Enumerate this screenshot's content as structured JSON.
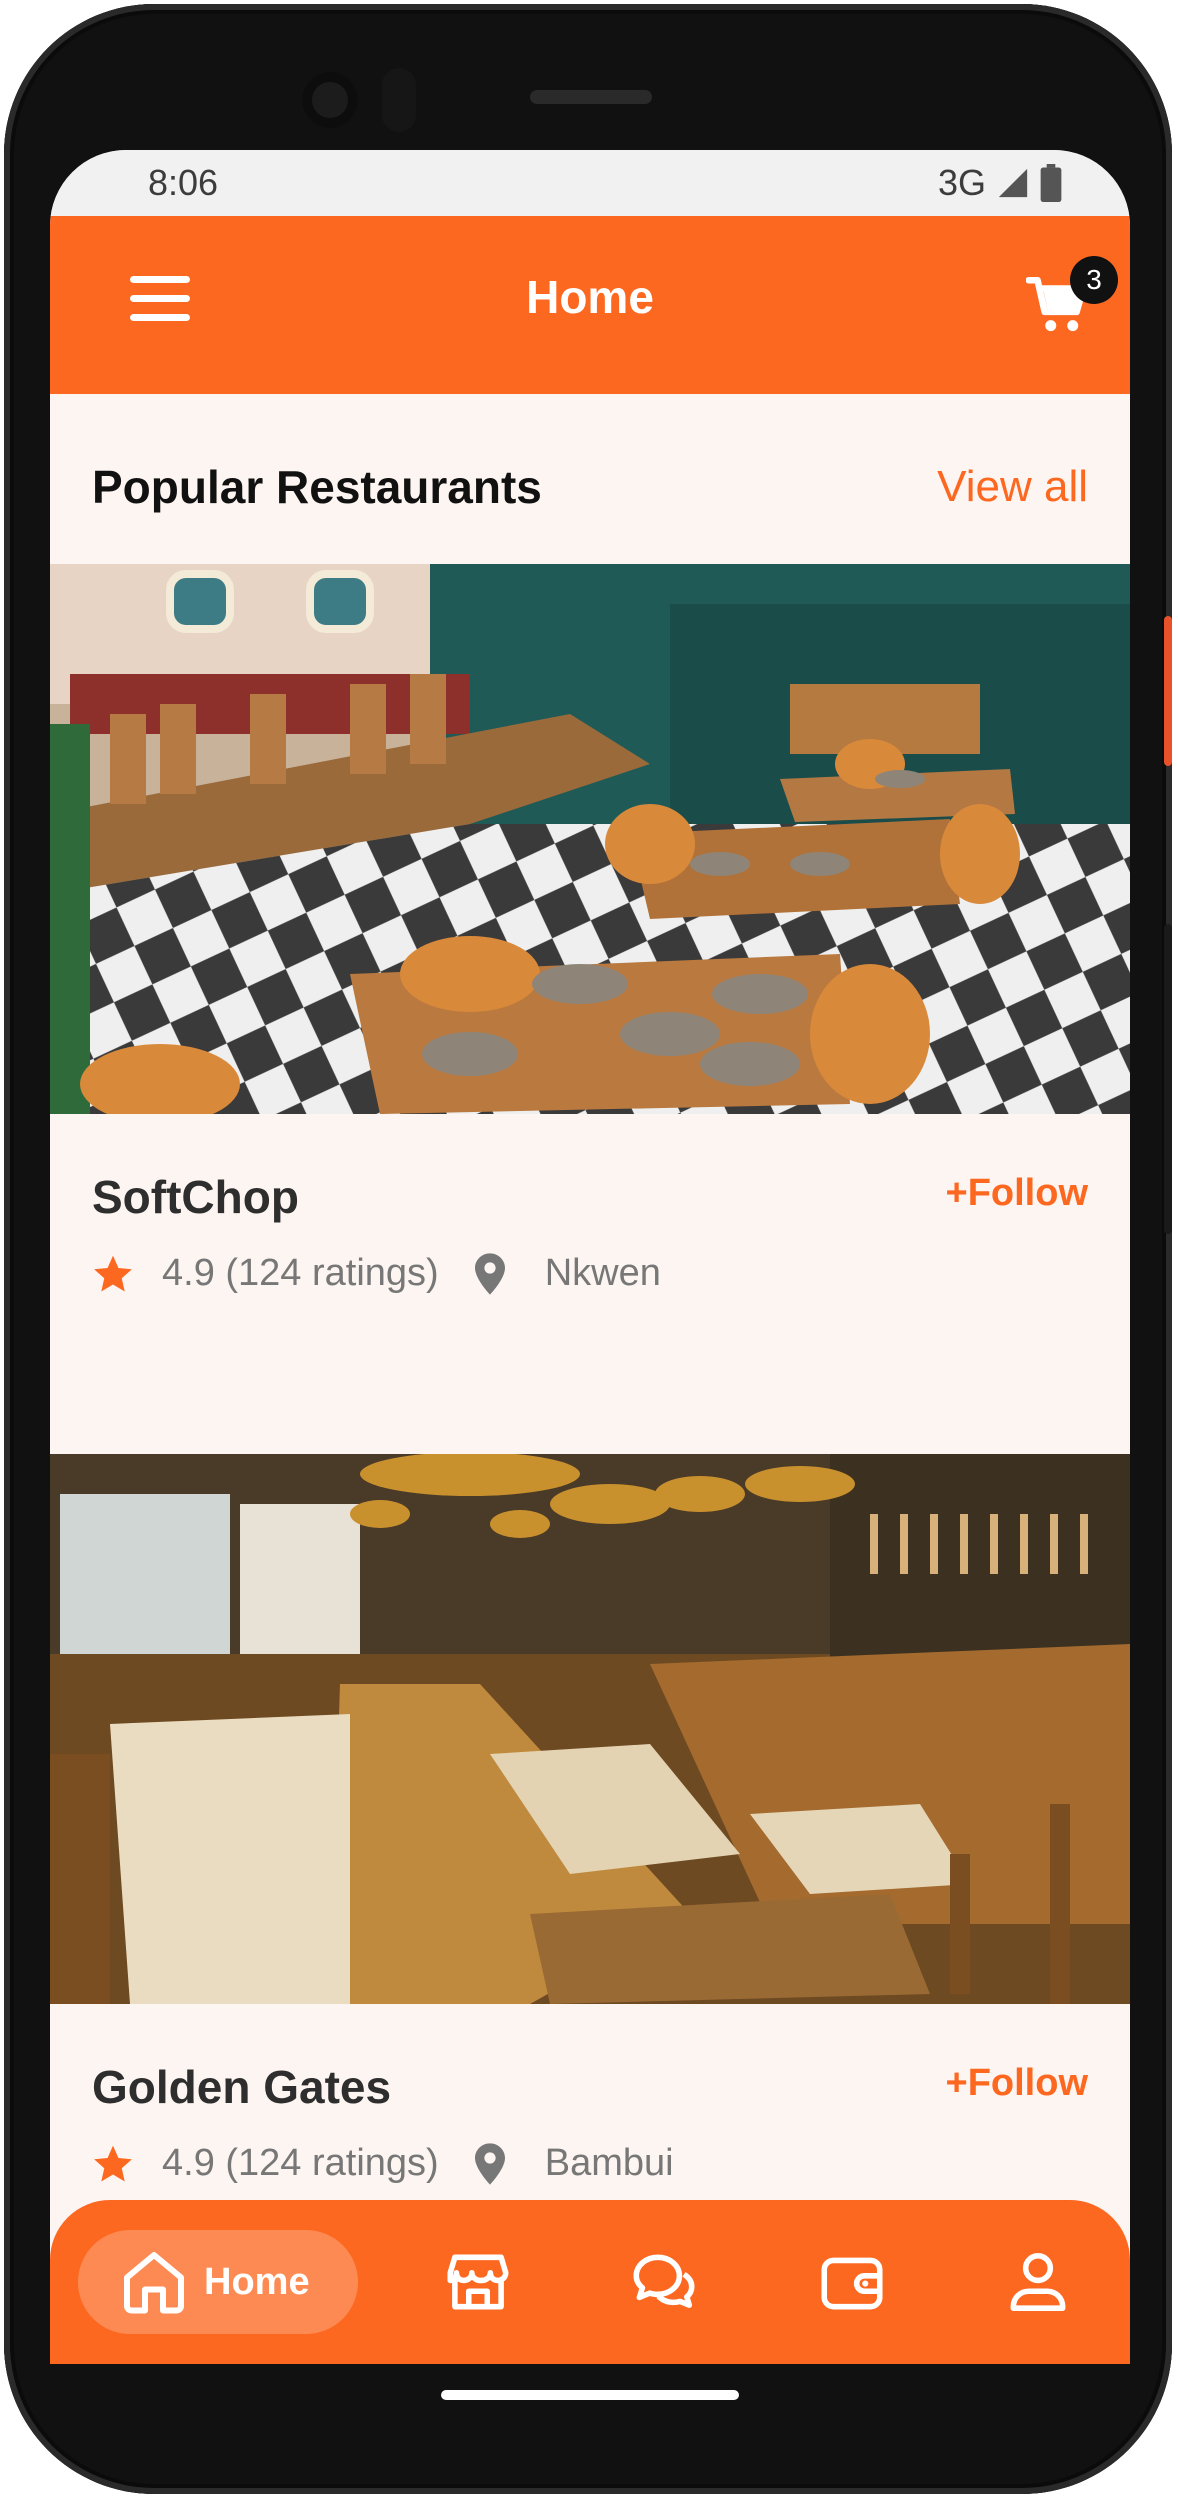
{
  "status_bar": {
    "time": "8:06",
    "network": "3G"
  },
  "app_bar": {
    "title": "Home",
    "cart_count": "3"
  },
  "section": {
    "title": "Popular Restaurants",
    "view_all": "View all"
  },
  "restaurants": [
    {
      "name": "SoftChop",
      "follow": "+Follow",
      "rating": "4.9 (124 ratings)",
      "location": "Nkwen"
    },
    {
      "name": "Golden Gates",
      "follow": "+Follow",
      "rating": "4.9 (124 ratings)",
      "location": "Bambui"
    }
  ],
  "bottom_nav": {
    "home_label": "Home"
  },
  "colors": {
    "accent": "#fd6821",
    "background": "#fdf5f1",
    "nav_active": "#fe8a53"
  }
}
